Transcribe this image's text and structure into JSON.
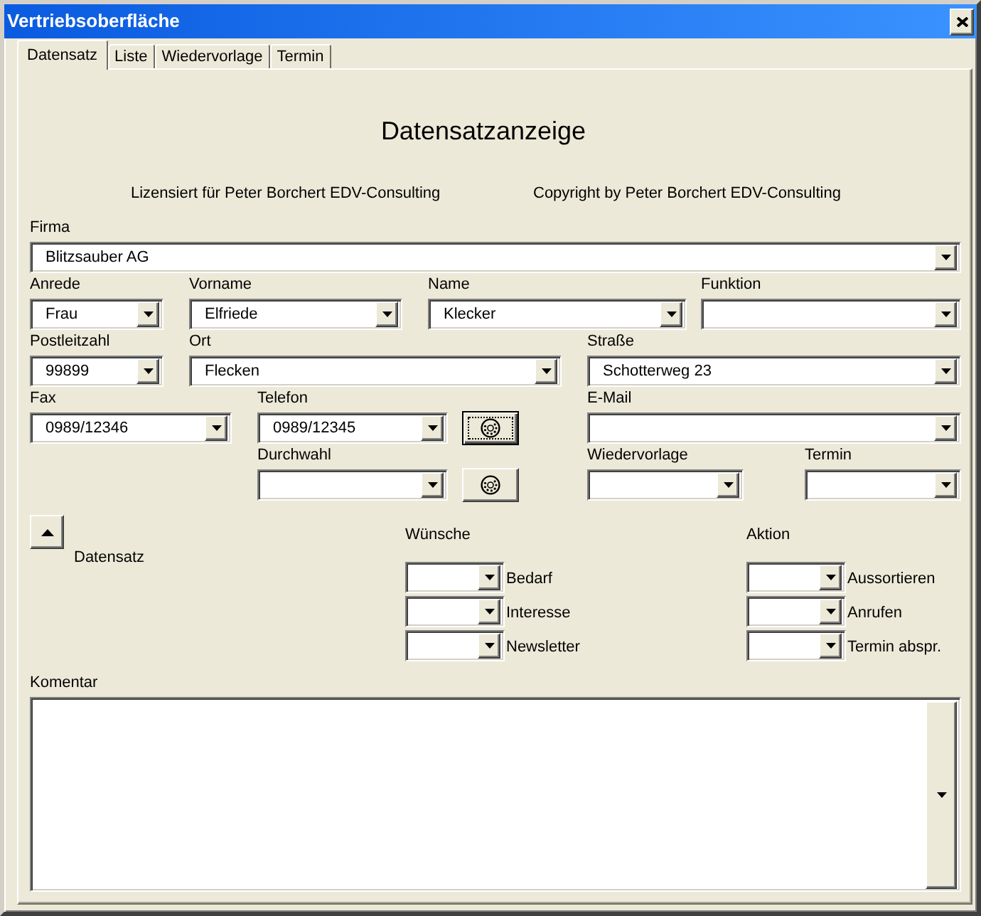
{
  "window": {
    "title": "Vertriebsoberfläche"
  },
  "tabs": [
    {
      "label": "Datensatz",
      "selected": true
    },
    {
      "label": "Liste",
      "selected": false
    },
    {
      "label": "Wiedervorlage",
      "selected": false
    },
    {
      "label": "Termin",
      "selected": false
    }
  ],
  "heading": "Datensatzanzeige",
  "license_lines": [
    "Lizensiert für Peter Borchert EDV-Consulting",
    "Copyright by Peter Borchert EDV-Consulting"
  ],
  "field_rows": [
    [
      {
        "kind": "combo",
        "label": "Firma",
        "value": "Blitzsauber AG"
      }
    ],
    [
      {
        "kind": "combo",
        "label": "Anrede",
        "value": "Frau"
      },
      {
        "kind": "combo",
        "label": "Vorname",
        "value": "Elfriede"
      },
      {
        "kind": "combo",
        "label": "Name",
        "value": "Klecker"
      },
      {
        "kind": "combo",
        "label": "Funktion"
      }
    ],
    [
      {
        "kind": "combo",
        "label": "Postleitzahl",
        "value": "99899"
      },
      {
        "kind": "combo",
        "label": "Ort",
        "value": "Flecken"
      },
      {
        "kind": "combo",
        "label": "Straße",
        "value": "Schotterweg 23"
      }
    ],
    [
      {
        "kind": "combo",
        "label": "Fax",
        "value": "0989/12346"
      },
      {
        "kind": "combo",
        "label": "Telefon",
        "value": "0989/12345"
      },
      {
        "kind": "dial_button",
        "focused": true
      },
      {
        "kind": "combo",
        "label": "E-Mail"
      }
    ],
    [
      {
        "kind": "combo",
        "label": "Durchwahl"
      },
      {
        "kind": "dial_button",
        "focused": false
      },
      {
        "kind": "combo",
        "label": "Wiedervorlage"
      },
      {
        "kind": "combo",
        "label": "Termin"
      }
    ]
  ],
  "record_nav": {
    "label": "Datensatz"
  },
  "wishes": {
    "title": "Wünsche",
    "items": [
      {
        "label": "Bedarf"
      },
      {
        "label": "Interesse"
      },
      {
        "label": "Newsletter"
      }
    ]
  },
  "actions": {
    "title": "Aktion",
    "items": [
      {
        "label": "Aussortieren"
      },
      {
        "label": "Anrufen"
      },
      {
        "label": "Termin abspr."
      }
    ]
  },
  "comment": {
    "label": "Komentar"
  }
}
